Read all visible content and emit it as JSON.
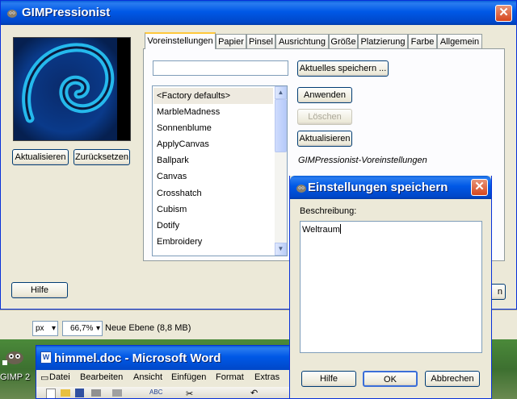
{
  "main_window": {
    "title": "GIMPressionist",
    "preview_buttons": {
      "refresh": "Aktualisieren",
      "reset": "Zurücksetzen"
    },
    "help_button": "Hilfe",
    "right_partial_label": "n",
    "tabs": [
      {
        "label": "Voreinstellungen"
      },
      {
        "label": "Papier"
      },
      {
        "label": "Pinsel"
      },
      {
        "label": "Ausrichtung"
      },
      {
        "label": "Größe"
      },
      {
        "label": "Platzierung"
      },
      {
        "label": "Farbe"
      },
      {
        "label": "Allgemein"
      }
    ],
    "presets": {
      "input_value": "",
      "items": [
        "<Factory defaults>",
        "MarbleMadness",
        "Sonnenblume",
        "ApplyCanvas",
        "Ballpark",
        "Canvas",
        "Crosshatch",
        "Cubism",
        "Dotify",
        "Embroidery"
      ],
      "selected_index": 0,
      "save_current_button": "Aktuelles speichern ...",
      "apply_button": "Anwenden",
      "delete_button": "Löschen",
      "refresh_button": "Aktualisieren",
      "description": "GIMPressionist-Voreinstellungen"
    }
  },
  "status_bar": {
    "unit": "px",
    "zoom": "66,7%",
    "layer_info": "Neue Ebene (8,8 MB)"
  },
  "desktop": {
    "gimp_label": "GIMP 2"
  },
  "word_window": {
    "title": "himmel.doc - Microsoft Word",
    "menu": [
      "Datei",
      "Bearbeiten",
      "Ansicht",
      "Einfügen",
      "Format",
      "Extras"
    ]
  },
  "save_dialog": {
    "title": "Einstellungen speichern",
    "description_label": "Beschreibung:",
    "description_value": "Weltraum",
    "buttons": {
      "help": "Hilfe",
      "ok": "OK",
      "cancel": "Abbrechen"
    }
  },
  "colors": {
    "xp_blue": "#0058e6",
    "xp_face": "#ece9d8",
    "tab_highlight": "#ffc83c",
    "close_red": "#d6461e"
  }
}
